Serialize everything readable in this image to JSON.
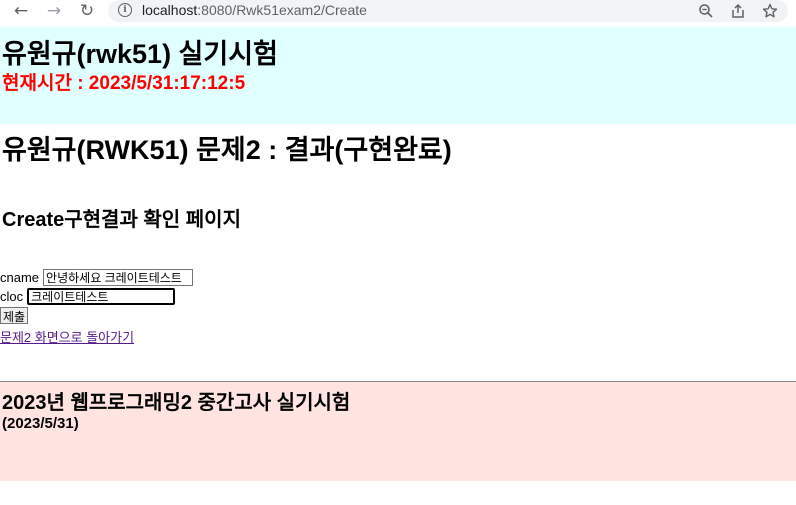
{
  "browser": {
    "back_icon": "arrow-left-icon",
    "forward_icon": "arrow-right-icon",
    "reload_icon": "reload-icon",
    "url_host": "localhost",
    "url_rest": ":8080/Rwk51exam2/Create"
  },
  "header": {
    "title": "유원규(rwk51) 실기시험",
    "time": "현재시간 : 2023/5/31:17:12:5",
    "background": "#e0ffff",
    "time_color": "#ff0000"
  },
  "main": {
    "problem_title": "유원규(RWK51) 문제2 : 결과(구현완료)",
    "subtitle": "Create구현결과 확인 페이지",
    "form": {
      "cname_label": "cname",
      "cname_value": "안녕하세요 크레이트테스트",
      "cloc_label": "cloc",
      "cloc_value": "크레이트테스트",
      "submit_label": "제출"
    },
    "back_link": "문제2 화면으로 돌아가기"
  },
  "footer": {
    "title": "2023년 웹프로그래밍2 중간고사 실기시험",
    "date": "(2023/5/31)",
    "background": "#ffe4e1"
  }
}
